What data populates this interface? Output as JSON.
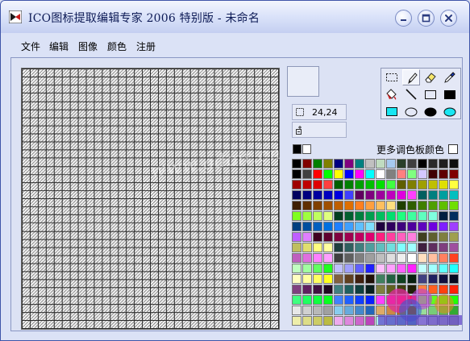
{
  "window": {
    "title": "ICO图标提取编辑专家 2006 特别版 - 未命名",
    "controls": [
      "minimize",
      "maximize",
      "close"
    ]
  },
  "menu": {
    "items": [
      "文件",
      "编辑",
      "图像",
      "颜色",
      "注册"
    ]
  },
  "editor": {
    "grid_cells": 32,
    "size_readout": "24,24",
    "position_readout": ""
  },
  "tools": [
    {
      "name": "rect-select-tool",
      "icon": "dashed-rectangle-icon"
    },
    {
      "name": "pencil-tool",
      "icon": "pencil-icon",
      "active": true
    },
    {
      "name": "eraser-tool",
      "icon": "eraser-icon"
    },
    {
      "name": "eyedropper-tool",
      "icon": "eyedropper-icon"
    },
    {
      "name": "fill-tool",
      "icon": "paint-bucket-icon"
    },
    {
      "name": "line-tool",
      "icon": "line-icon"
    },
    {
      "name": "rectangle-tool",
      "icon": "rectangle-outline-icon"
    },
    {
      "name": "filled-rectangle-tool",
      "icon": "filled-rectangle-icon"
    },
    {
      "name": "filled-rectangle-alt-tool",
      "icon": "cyan-filled-rectangle-icon"
    },
    {
      "name": "ellipse-tool",
      "icon": "ellipse-outline-icon"
    },
    {
      "name": "filled-ellipse-tool",
      "icon": "filled-ellipse-icon"
    },
    {
      "name": "filled-ellipse-alt-tool",
      "icon": "cyan-filled-ellipse-icon"
    }
  ],
  "colors": {
    "foreground": "#000000",
    "background": "#ffffff",
    "more_palette_label": "更多调色板颜色",
    "more_palette_checked": false
  },
  "palette": {
    "columns": 16,
    "rows": 16,
    "row_palettes": [
      [
        "#000000",
        "#800000",
        "#008000",
        "#808000",
        "#000080",
        "#800080",
        "#008080",
        "#c0c0c0",
        "#c0dcc0",
        "#a6caf0",
        "#2a3f2a",
        "#3f3f3f",
        "#000000",
        "#2a2a2a",
        "#1f1f1f",
        "#0f0f0f"
      ],
      [
        "#000000",
        "#404040",
        "#ff0000",
        "#00ff00",
        "#ffff00",
        "#0000ff",
        "#ff00ff",
        "#00ffff",
        "#ffffff",
        "#808080",
        "#ff8080",
        "#80ff80",
        "#d4c8ff",
        "#3f0000",
        "#5f0000",
        "#7f0000"
      ],
      [
        "#9f0000",
        "#bf0000",
        "#df0000",
        "#ff3f3f",
        "#005f00",
        "#007f00",
        "#009f00",
        "#00bf00",
        "#00df00",
        "#3fff3f",
        "#5f5f00",
        "#7f7f00",
        "#9f9f00",
        "#bfbf00",
        "#dfdf00",
        "#ffff3f"
      ],
      [
        "#00005f",
        "#00007f",
        "#00009f",
        "#0000bf",
        "#0000df",
        "#3f3fff",
        "#5f005f",
        "#7f007f",
        "#9f009f",
        "#bf00bf",
        "#df00df",
        "#ff3fff",
        "#005f5f",
        "#007f7f",
        "#009f9f",
        "#00bfbf"
      ],
      [
        "#3f1f00",
        "#5f2f00",
        "#7f3f00",
        "#9f4f00",
        "#bf5f00",
        "#df6f00",
        "#ff7f1f",
        "#ff9f3f",
        "#ffbf5f",
        "#ffdf7f",
        "#1f3f00",
        "#2f5f00",
        "#3f7f00",
        "#4f9f00",
        "#5fbf00",
        "#6fdf00"
      ],
      [
        "#7fff1f",
        "#9fff3f",
        "#bfff5f",
        "#dfff7f",
        "#003f1f",
        "#005f2f",
        "#007f3f",
        "#009f4f",
        "#00bf5f",
        "#00df6f",
        "#1fff7f",
        "#3fff9f",
        "#5fffbf",
        "#7fffdf",
        "#001f3f",
        "#002f5f"
      ],
      [
        "#003f7f",
        "#004f9f",
        "#005fbf",
        "#006fdf",
        "#1f7fff",
        "#3f9fff",
        "#5fbfff",
        "#7fdfff",
        "#1f003f",
        "#2f005f",
        "#3f007f",
        "#4f009f",
        "#5f00bf",
        "#6f00df",
        "#7f1fff",
        "#9f3fff"
      ],
      [
        "#bf5fff",
        "#df7fff",
        "#3f001f",
        "#5f002f",
        "#7f003f",
        "#9f004f",
        "#bf005f",
        "#df006f",
        "#ff1f7f",
        "#ff3f9f",
        "#ff5fbf",
        "#ff7fdf",
        "#3f3f1f",
        "#5f5f2f",
        "#7f7f3f",
        "#9f9f4f"
      ],
      [
        "#bfbf5f",
        "#dfdf6f",
        "#ffff7f",
        "#ffff9f",
        "#1f3f3f",
        "#2f5f5f",
        "#3f7f7f",
        "#4f9f9f",
        "#5fbfbf",
        "#6fdfdf",
        "#7fffff",
        "#9fffff",
        "#3f1f3f",
        "#5f2f5f",
        "#7f3f7f",
        "#9f4f9f"
      ],
      [
        "#bf5fbf",
        "#df6fdf",
        "#ff7fff",
        "#ff9fff",
        "#3f3f3f",
        "#5f5f5f",
        "#7f7f7f",
        "#9f9f9f",
        "#bfbfbf",
        "#dfdfdf",
        "#efefef",
        "#ffffff",
        "#ffe0c0",
        "#ffc0a0",
        "#ff8060",
        "#ff4020"
      ],
      [
        "#c0ffc0",
        "#a0ffa0",
        "#60ff60",
        "#20ff20",
        "#c0c0ff",
        "#a0a0ff",
        "#6060ff",
        "#2020ff",
        "#ffc0ff",
        "#ffa0ff",
        "#ff60ff",
        "#ff20ff",
        "#c0ffff",
        "#a0ffff",
        "#60ffff",
        "#20ffff"
      ],
      [
        "#ffffc0",
        "#ffffa0",
        "#ffff60",
        "#ffff20",
        "#806040",
        "#604020",
        "#402010",
        "#201008",
        "#408060",
        "#206040",
        "#104020",
        "#082010",
        "#404080",
        "#202060",
        "#101040",
        "#080820"
      ],
      [
        "#804080",
        "#602060",
        "#401040",
        "#200820",
        "#408080",
        "#206060",
        "#104040",
        "#082020",
        "#808040",
        "#606020",
        "#404010",
        "#202008",
        "#ff8040",
        "#ff6020",
        "#ff4010",
        "#ff2008"
      ],
      [
        "#40ff80",
        "#20ff60",
        "#10ff40",
        "#08ff20",
        "#4080ff",
        "#2060ff",
        "#1040ff",
        "#0820ff",
        "#ff40ff",
        "#ff20c0",
        "#ff1080",
        "#ff0840",
        "#80ff40",
        "#60ff20",
        "#40ff10",
        "#20ff08"
      ],
      [
        "#e8e8e8",
        "#d0d0d0",
        "#b8b8b8",
        "#a0a0a0",
        "#88ccee",
        "#66aadd",
        "#4488cc",
        "#2266bb",
        "#ddaa66",
        "#cc8844",
        "#bb6622",
        "#aa4400",
        "#99dd99",
        "#77cc77",
        "#55bb55",
        "#33aa33"
      ],
      [
        "#eeeeaa",
        "#dddd88",
        "#cccc66",
        "#bbbb44",
        "#eeaaee",
        "#dd88dd",
        "#cc66cc",
        "#bb44bb",
        "#aaeeee",
        "#88dddd",
        "#66cccc",
        "#44bbbb",
        "#f0f0f0",
        "#d8d8d8",
        "#c8c8c8",
        "#b0b0b0"
      ]
    ]
  },
  "overlay": {
    "watermark_text": "www.gdoit.cn"
  }
}
